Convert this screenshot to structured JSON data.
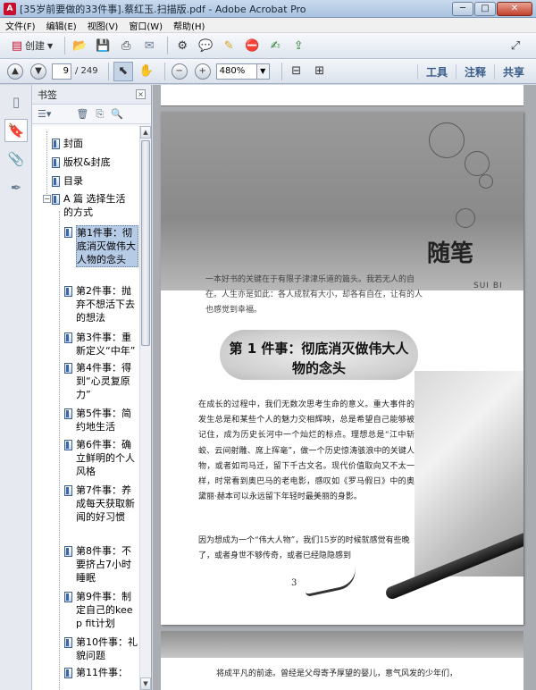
{
  "window": {
    "title": "[35岁前要做的33件事].蔡红玉.扫描版.pdf - Adobe Acrobat Pro",
    "app_icon": "A",
    "min_label": "─",
    "max_label": "□",
    "close_label": "✕"
  },
  "menu": [
    "文件(F)",
    "编辑(E)",
    "视图(V)",
    "窗口(W)",
    "帮助(H)"
  ],
  "toolbar": {
    "create_label": "创建",
    "page_current": "9",
    "page_total": "/ 249",
    "zoom": "480%",
    "right_tabs": [
      "工具",
      "注释",
      "共享"
    ]
  },
  "panel": {
    "title": "书签",
    "close_label": "×"
  },
  "bookmarks": [
    {
      "label": "封面"
    },
    {
      "label": "版权&封底"
    },
    {
      "label": "目录"
    },
    {
      "label": "A 篇 选择生活的方式",
      "expander": "−"
    },
    {
      "label": "第1件事：彻底消灭做伟大人物的念头",
      "selected": true
    },
    {
      "label": "第2件事：抛弃不想活下去的想法"
    },
    {
      "label": "第3件事：重新定义“中年”"
    },
    {
      "label": "第4件事：得到“心灵复原力”"
    },
    {
      "label": "第5件事：简约地生活"
    },
    {
      "label": "第6件事：确立鲜明的个人风格"
    },
    {
      "label": "第7件事：养成每天获取新闻的好习惯"
    },
    {
      "label": "第8件事：不要挤占7小时睡眠"
    },
    {
      "label": "第9件事：制定自己的keep fit计划"
    },
    {
      "label": "第10件事：礼貌问题"
    },
    {
      "label": "第11件事："
    }
  ],
  "document": {
    "side_title": "随笔",
    "side_title_en": "SUI BI",
    "intro": "一本好书的关键在于有限子津津乐道的篇头。我若无人的自在。人生亦是如此：各人成就有大小，却各有自在，让有的人也感觉到幸福。",
    "chapter_title": "第 1 件事：彻底消灭做伟大人物的念头",
    "body_text": "在成长的过程中，我们无数次思考生命的意义。重大事件的发生总是和某些个人的魅力交相辉映，总是希望自己能够被记住，成为历史长河中一个灿烂的标点。理想总是“江中斩蛟、云间射雕、席上挥毫”，做一个历史惊涛骇浪中的关键人物，或者如司马迁，留下千古文名。现代价值取向又不太一样，时常看到奥巴马的老电影，感叹如《罗马假日》中的奥黛丽·赫本可以永远留下年轻时最美丽的身影。",
    "body_text2": "因为想成为一个“伟大人物”，我们15岁的时候就感觉有些晚了，或者身世不够传奇，或者已经隐隐感到",
    "page_number": "3",
    "page2_text": "将成平凡的前途。曾经是父母寄予厚望的婴儿，意气风发的少年们，"
  }
}
